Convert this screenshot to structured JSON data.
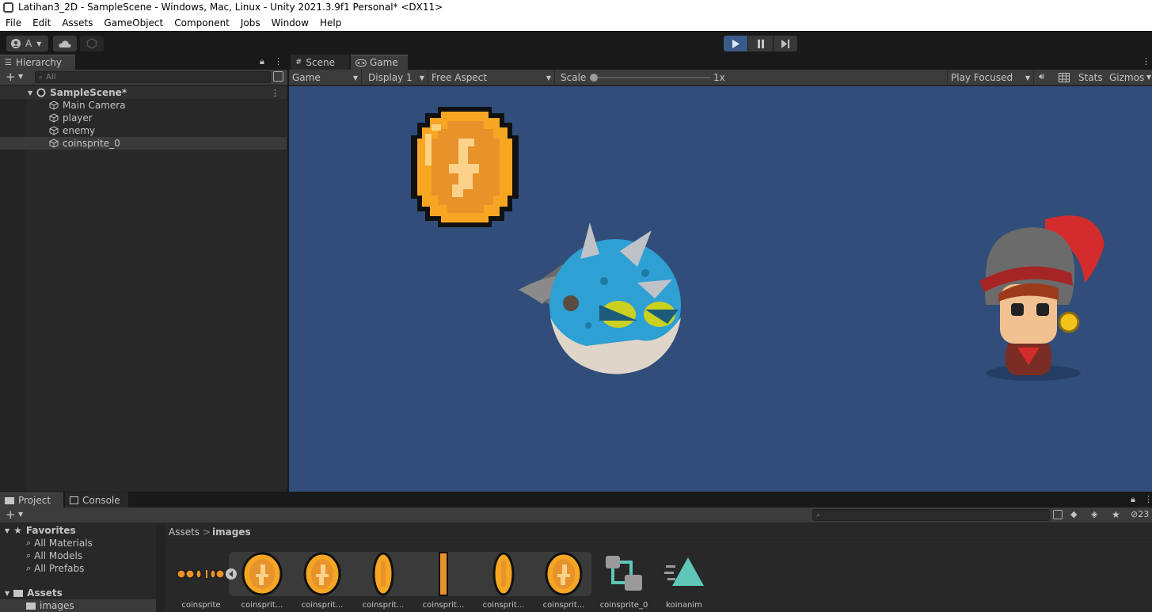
{
  "window": {
    "title": "Latihan3_2D - SampleScene - Windows, Mac, Linux - Unity 2021.3.9f1 Personal* <DX11>"
  },
  "menu": [
    "File",
    "Edit",
    "Assets",
    "GameObject",
    "Component",
    "Jobs",
    "Window",
    "Help"
  ],
  "toolbar": {
    "account_label": "A",
    "play_icon": "play-icon",
    "pause_icon": "pause-icon",
    "step_icon": "step-icon"
  },
  "hierarchy": {
    "tab_label": "Hierarchy",
    "search_placeholder": "All",
    "scene_name": "SampleScene*",
    "objects": [
      "Main Camera",
      "player",
      "enemy",
      "coinsprite_0"
    ],
    "selected": "coinsprite_0"
  },
  "game_view": {
    "tabs": {
      "scene": "Scene",
      "game": "Game"
    },
    "view_mode": "Game",
    "display": "Display 1",
    "aspect": "Free Aspect",
    "scale_label": "Scale",
    "scale_value": "1x",
    "play_mode": "Play Focused",
    "stats": "Stats",
    "gizmos": "Gizmos",
    "background_color": "#314d79"
  },
  "project": {
    "tabs": {
      "project": "Project",
      "console": "Console"
    },
    "favorites_label": "Favorites",
    "favorites": [
      "All Materials",
      "All Models",
      "All Prefabs"
    ],
    "assets_label": "Assets",
    "folders": [
      "images"
    ],
    "breadcrumb": {
      "root": "Assets",
      "sep": ">",
      "current": "images"
    },
    "visible_count": "23",
    "assets": [
      "coinsprite",
      "coinsprit...",
      "coinsprit...",
      "coinsprit...",
      "coinsprit...",
      "coinsprit...",
      "coinsprit...",
      "coinsprite_0",
      "koinanim"
    ]
  }
}
